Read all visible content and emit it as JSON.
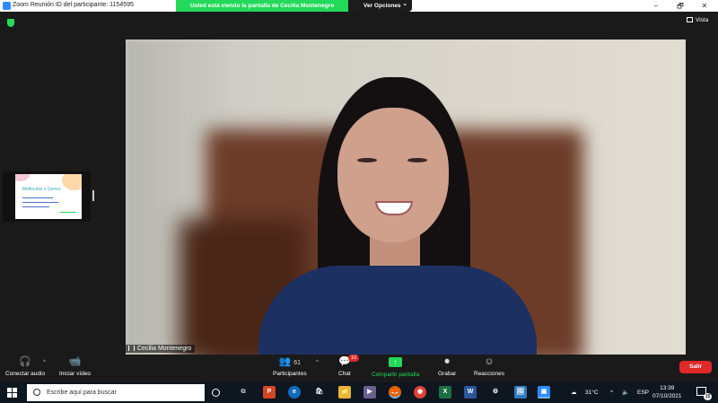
{
  "window": {
    "title": "Zoom Reunión ID del participante: 1154595",
    "minimize_icon": "–",
    "restore_icon": "🗗",
    "close_icon": "✕"
  },
  "share_banner": {
    "text": "Usted está viendo la pantalla de Cecilia Montenegro"
  },
  "view_options": {
    "label": "Ver Opciones",
    "chevron": "⌄"
  },
  "meeting": {
    "view_label": "Vista",
    "shared_slide": {
      "title": "Moléculas y Genes"
    },
    "speaker_name": "Cecilia Montenegro"
  },
  "controls": {
    "audio": {
      "label": "Conectar audio",
      "icon": "🎧"
    },
    "video": {
      "label": "Iniciar vídeo",
      "icon": "📹"
    },
    "participants": {
      "label": "Participantes",
      "count": "61",
      "icon": "👥"
    },
    "chat": {
      "label": "Chat",
      "badge": "10",
      "icon": "💬"
    },
    "share": {
      "label": "Compartir pantalla",
      "icon": "↑"
    },
    "record": {
      "label": "Grabar",
      "icon": "⏺"
    },
    "reactions": {
      "label": "Reacciones",
      "icon": "☺"
    },
    "leave": {
      "label": "Salir"
    },
    "caret": "^"
  },
  "taskbar": {
    "search_placeholder": "Escribe aquí para buscar",
    "apps": [
      "P",
      "e",
      "🛍",
      "📁",
      "▶",
      "🦊",
      "◉",
      "X",
      "W",
      "⚙",
      "🖼",
      "▣"
    ],
    "weather": "31°C",
    "language": "ESP",
    "time": "13:39",
    "date": "07/10/2021",
    "notifications": "15"
  },
  "colors": {
    "accent_green": "#23d959",
    "zoom_blue": "#2d8cff",
    "leave_red": "#e02828"
  }
}
